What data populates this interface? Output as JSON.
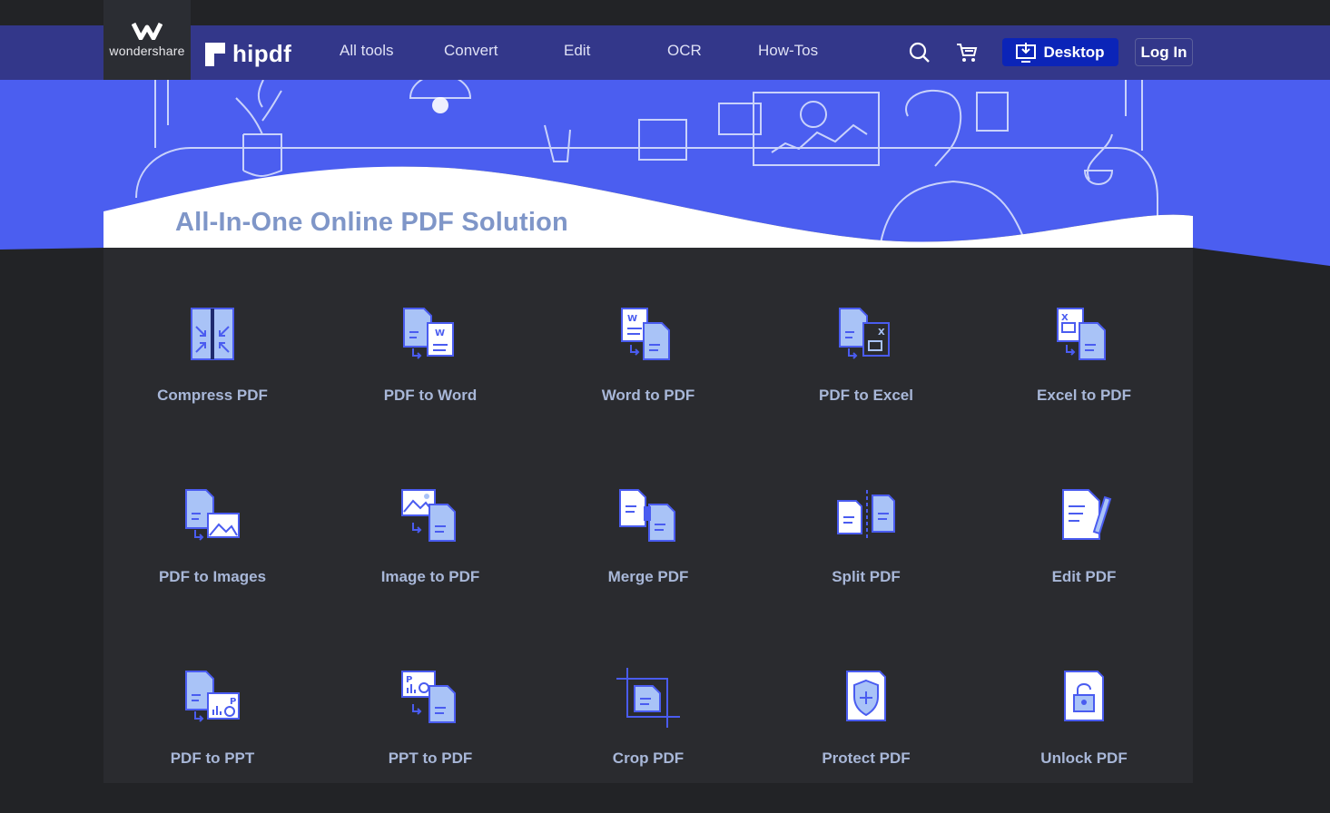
{
  "header": {
    "brand_name": "wondershare",
    "logo_text": "hipdf",
    "nav": [
      "All tools",
      "Convert",
      "Edit",
      "OCR",
      "How-Tos"
    ],
    "icons": [
      "search-icon",
      "cart-icon"
    ],
    "desktop_label": "Desktop",
    "login_label": "Log In"
  },
  "hero": {
    "title": "All-In-One Online PDF Solution"
  },
  "tools": [
    {
      "label": "Compress PDF",
      "icon": "compress-icon"
    },
    {
      "label": "PDF to Word",
      "icon": "pdf-to-word-icon"
    },
    {
      "label": "Word to PDF",
      "icon": "word-to-pdf-icon"
    },
    {
      "label": "PDF to Excel",
      "icon": "pdf-to-excel-icon"
    },
    {
      "label": "Excel to PDF",
      "icon": "excel-to-pdf-icon"
    },
    {
      "label": "PDF to Images",
      "icon": "pdf-to-images-icon"
    },
    {
      "label": "Image to PDF",
      "icon": "image-to-pdf-icon"
    },
    {
      "label": "Merge PDF",
      "icon": "merge-icon"
    },
    {
      "label": "Split PDF",
      "icon": "split-icon"
    },
    {
      "label": "Edit PDF",
      "icon": "edit-icon"
    },
    {
      "label": "PDF to PPT",
      "icon": "pdf-to-ppt-icon"
    },
    {
      "label": "PPT to PDF",
      "icon": "ppt-to-pdf-icon"
    },
    {
      "label": "Crop PDF",
      "icon": "crop-icon"
    },
    {
      "label": "Protect PDF",
      "icon": "protect-icon"
    },
    {
      "label": "Unlock PDF",
      "icon": "unlock-icon"
    }
  ],
  "colors": {
    "background": "#222326",
    "navbar": "#33378a",
    "hero_blue": "#4b5ef0",
    "accent": "#0b24b8",
    "tool_label": "#a8b7d8",
    "icon_fill": "#a9c3f7",
    "icon_stroke": "#4a5cf0"
  }
}
